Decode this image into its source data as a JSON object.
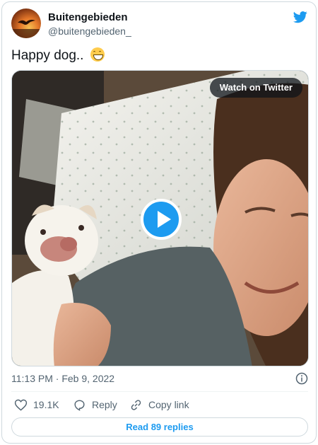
{
  "author": {
    "name": "Buitengebieden",
    "handle": "@buitengebieden_"
  },
  "tweet": {
    "text": "Happy dog.. ",
    "emoji": "grinning-face-with-smiling-eyes"
  },
  "media": {
    "watch_label": "Watch on Twitter",
    "play_icon": "play-icon"
  },
  "meta": {
    "timestamp": "11:13 PM · Feb 9, 2022"
  },
  "actions": {
    "like_count": "19.1K",
    "reply_label": "Reply",
    "copy_label": "Copy link"
  },
  "read_replies_label": "Read 89 replies",
  "colors": {
    "accent": "#1d9bf0",
    "text_secondary": "#536471",
    "border": "#cfd9de"
  }
}
